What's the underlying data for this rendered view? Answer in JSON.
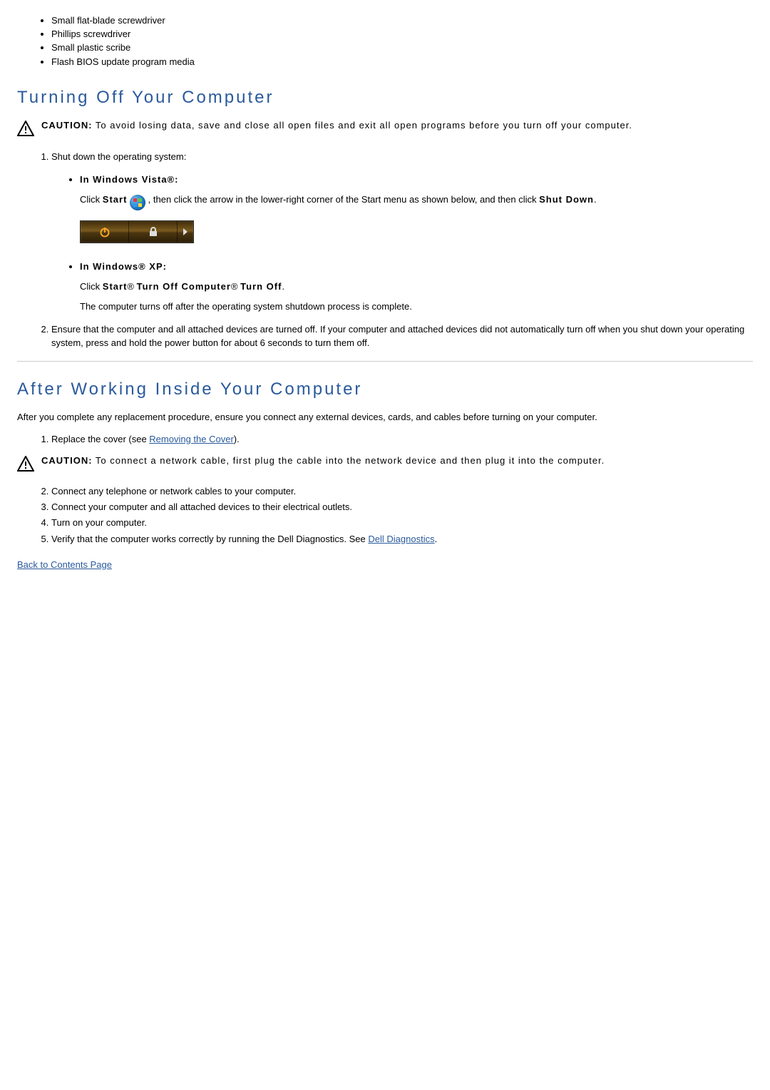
{
  "tools": {
    "items": [
      "Small flat-blade screwdriver",
      "Phillips screwdriver",
      "Small plastic scribe",
      "Flash BIOS update program media"
    ]
  },
  "section1": {
    "heading": "Turning Off Your Computer",
    "caution_label": "CAUTION:",
    "caution_text": " To avoid losing data, save and close all open files and exit all open programs before you turn off your computer.",
    "step1_intro": "Shut down the operating system:",
    "vista_label": "In Windows Vista®:",
    "vista_click_a": "Click ",
    "vista_start_word": "Start",
    "vista_click_b": " , then click the arrow in the lower-right corner of the Start menu as shown below, and then click ",
    "vista_shutdown_word": "Shut Down",
    "vista_period": ".",
    "xp_label": "In Windows® XP:",
    "xp_line_a": "Click ",
    "xp_start": "Start",
    "xp_arrow1": "® ",
    "xp_turn_off_computer": "Turn Off Computer",
    "xp_arrow2": "® ",
    "xp_turn_off": "Turn Off",
    "xp_line_end": ".",
    "xp_result": "The computer turns off after the operating system shutdown process is complete.",
    "step2": "Ensure that the computer and all attached devices are turned off. If your computer and attached devices did not automatically turn off when you shut down your operating system, press and hold the power button for about 6 seconds to turn them off."
  },
  "section2": {
    "heading": "After Working Inside Your Computer",
    "intro": "After you complete any replacement procedure, ensure you connect any external devices, cards, and cables before turning on your computer.",
    "step1_a": "Replace the cover (see ",
    "step1_link": "Removing the Cover",
    "step1_b": ").",
    "caution_label": "CAUTION:",
    "caution_text": " To connect a network cable, first plug the cable into the network device and then plug it into the computer.",
    "step2": "Connect any telephone or network cables to your computer.",
    "step3": "Connect your computer and all attached devices to their electrical outlets.",
    "step4": "Turn on your computer.",
    "step5_a": "Verify that the computer works correctly by running the Dell Diagnostics. See ",
    "step5_link": "Dell Diagnostics",
    "step5_b": "."
  },
  "back_link": "Back to Contents Page"
}
